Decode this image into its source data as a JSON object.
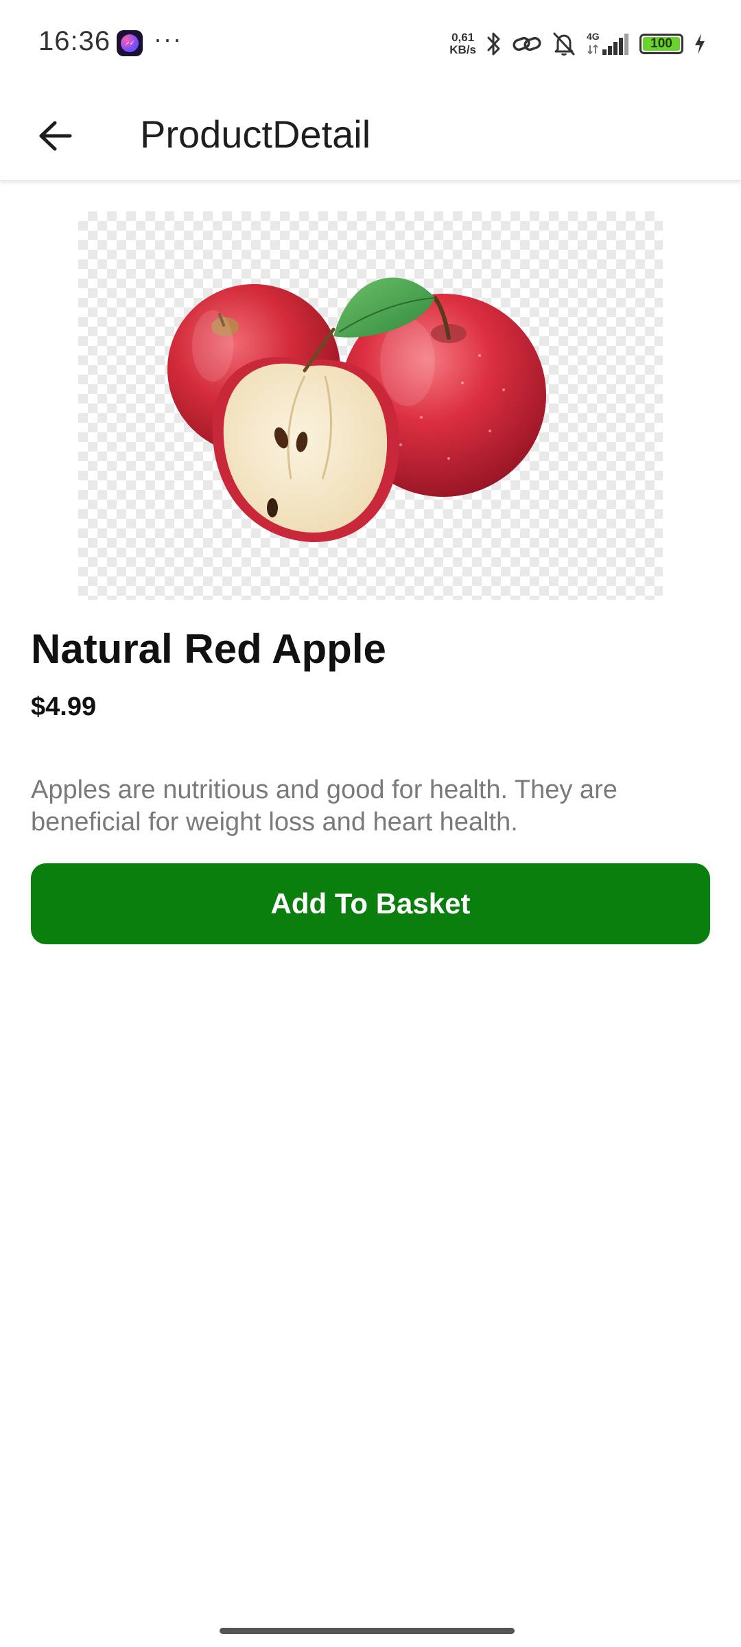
{
  "status_bar": {
    "time": "16:36",
    "overflow_indicator": "···",
    "network_speed_value": "0,61",
    "network_speed_unit": "KB/s",
    "network_type": "4G",
    "battery_level": "100",
    "icons": [
      "messenger-icon",
      "bluetooth-icon",
      "link-icon",
      "bell-off-icon",
      "signal-icon",
      "battery-icon",
      "charging-icon"
    ]
  },
  "app_bar": {
    "title": "ProductDetail",
    "back_icon": "arrow-back-icon"
  },
  "product": {
    "image_alt": "Natural Red Apple",
    "name": "Natural Red Apple",
    "price": "$4.99",
    "description": "Apples are nutritious and good for health. They are beneficial for weight loss and heart health."
  },
  "actions": {
    "add_to_basket_label": "Add To Basket"
  },
  "colors": {
    "primary_button": "#0b7f0d",
    "description_text": "#7a7a7a",
    "battery_fill": "#6bd12f"
  }
}
